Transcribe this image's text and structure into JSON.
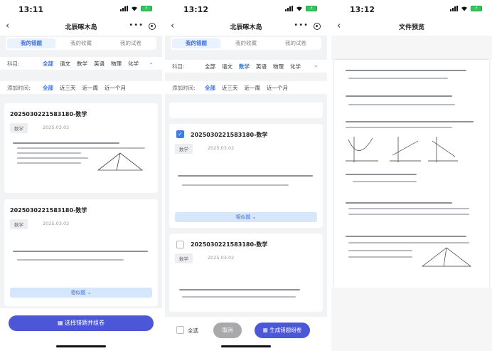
{
  "phone1": {
    "time": "13:11",
    "title": "北辰啄木岛",
    "tabs": [
      "我的错题",
      "我的收藏",
      "我的试卷"
    ],
    "subject_label": "科目:",
    "subjects": [
      "全部",
      "语文",
      "数学",
      "英语",
      "物理",
      "化学"
    ],
    "time_label": "添加时间:",
    "times": [
      "全部",
      "近三天",
      "近一周",
      "近一个月"
    ],
    "cards": [
      {
        "title": "202503022158318 0-数学",
        "tag": "数学",
        "date": "2025.03.02"
      },
      {
        "title": "2025030221583180-数学",
        "tag": "数学",
        "date": "2025.03.02"
      }
    ],
    "similar": "相似题",
    "action": "选择错题并组卷"
  },
  "phone2": {
    "time": "13:12",
    "title": "北辰啄木岛",
    "tabs": [
      "我的错题",
      "我的收藏",
      "我的试卷"
    ],
    "subject_label": "科目:",
    "subjects": [
      "全部",
      "语文",
      "数学",
      "英语",
      "物理",
      "化学"
    ],
    "time_label": "添加时间:",
    "times": [
      "全部",
      "近三天",
      "近一周",
      "近一个月"
    ],
    "cards": [
      {
        "title": "2025030221583180-数学",
        "tag": "数学",
        "date": "2025.03.02"
      },
      {
        "title": "2025030221583180-数学",
        "tag": "数学",
        "date": "2025.03.02"
      }
    ],
    "similar": "相似题",
    "select_all": "全选",
    "cancel": "取消",
    "generate": "生成错题组卷"
  },
  "phone3": {
    "time": "13:12",
    "title": "文件预览"
  },
  "colors": {
    "accent": "#3d6fe0",
    "button": "#4c57d8",
    "check": "#3b7ce6"
  }
}
